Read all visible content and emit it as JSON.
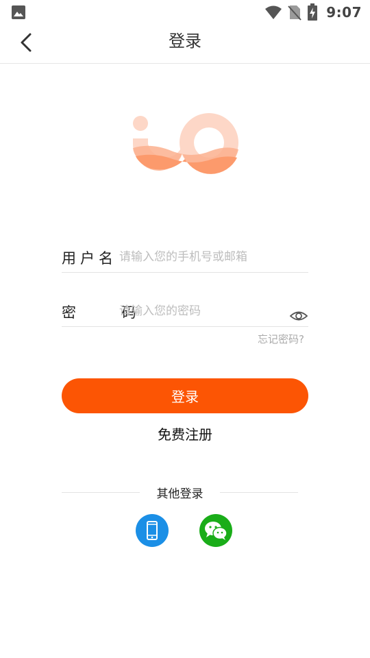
{
  "status_bar": {
    "time": "9:07",
    "icons": [
      "gallery-icon",
      "wifi-icon",
      "no-sim-icon",
      "battery-charging-icon"
    ]
  },
  "header": {
    "title": "登录",
    "back_icon": "chevron-left-icon"
  },
  "form": {
    "username_label": "用户名",
    "username_placeholder": "请输入您的手机号或邮箱",
    "username_value": "",
    "password_label": "密 码",
    "password_placeholder": "请输入您的密码",
    "password_value": "",
    "show_password_icon": "eye-icon",
    "forgot_label": "忘记密码?"
  },
  "actions": {
    "login_label": "登录",
    "register_label": "免费注册"
  },
  "other_login": {
    "title": "其他登录",
    "methods": [
      "phone-icon",
      "wechat-icon"
    ]
  },
  "colors": {
    "accent": "#fc5504",
    "phone": "#1b8fe6",
    "wechat": "#1aad19",
    "logo_light": "#fdd7c7",
    "logo_dark": "#fc9a6c"
  }
}
